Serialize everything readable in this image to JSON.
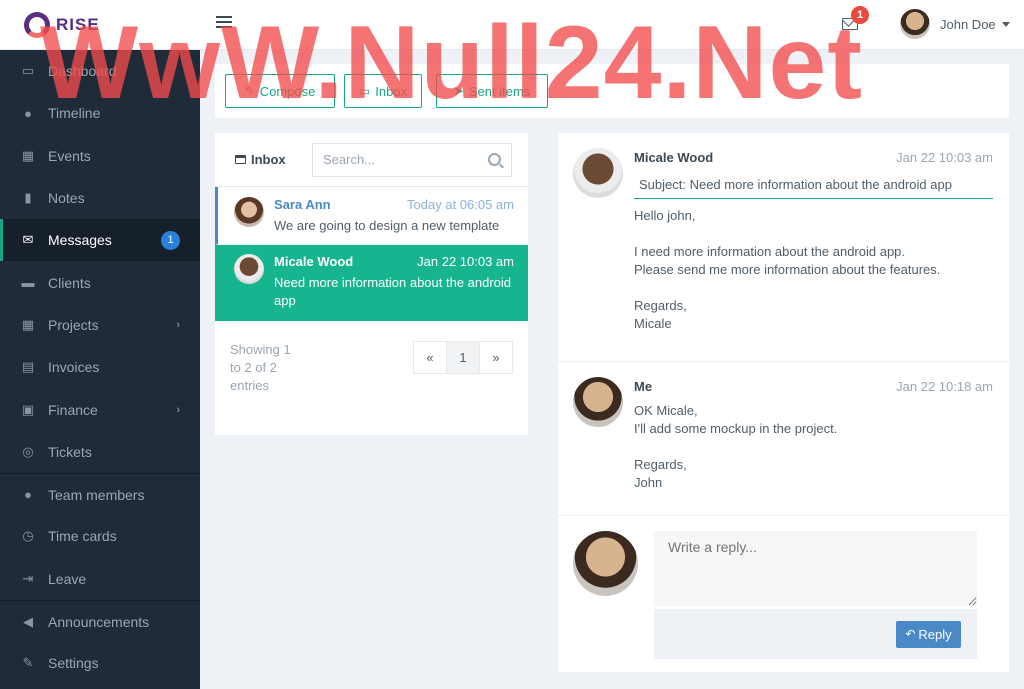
{
  "app": {
    "brand": "RISE"
  },
  "header": {
    "notification_count": "1",
    "user_name": "John Doe"
  },
  "sidebar": {
    "items": [
      {
        "label": "Dashboard",
        "icon": "monitor-icon"
      },
      {
        "label": "Timeline",
        "icon": "comments-icon"
      },
      {
        "label": "Events",
        "icon": "calendar-icon"
      },
      {
        "label": "Notes",
        "icon": "book-icon"
      },
      {
        "label": "Messages",
        "icon": "envelope-icon",
        "badge": "1",
        "active": true
      },
      {
        "label": "Clients",
        "icon": "briefcase-icon"
      },
      {
        "label": "Projects",
        "icon": "grid-icon"
      },
      {
        "label": "Invoices",
        "icon": "file-icon"
      },
      {
        "label": "Finance",
        "icon": "money-icon"
      },
      {
        "label": "Tickets",
        "icon": "lifebuoy-icon"
      },
      {
        "label": "Team members",
        "icon": "user-icon"
      },
      {
        "label": "Time cards",
        "icon": "clock-icon"
      },
      {
        "label": "Leave",
        "icon": "sign-out-icon"
      },
      {
        "label": "Announcements",
        "icon": "bullhorn-icon"
      },
      {
        "label": "Settings",
        "icon": "wrench-icon"
      }
    ]
  },
  "tabs": {
    "compose": "Compose",
    "inbox": "Inbox",
    "sent": "Sent items"
  },
  "inbox": {
    "title": "Inbox",
    "search_placeholder": "Search...",
    "messages": [
      {
        "from": "Sara Ann",
        "date": "Today at 06:05 am",
        "subject": "We are going to design a new template"
      },
      {
        "from": "Micale Wood",
        "date": "Jan 22 10:03 am",
        "subject": "Need more information about the android app"
      }
    ],
    "showing": "Showing 1 to 2 of 2 entries",
    "pager": {
      "prev": "«",
      "page": "1",
      "next": "»"
    }
  },
  "view": {
    "thread": [
      {
        "from": "Micale Wood",
        "date": "Jan 22 10:03 am",
        "subject": "Subject: Need more information about the android app",
        "body": "Hello john,\n\nI need more information about the android app.\nPlease send me more information about the features.\n\nRegards,\nMicale"
      },
      {
        "from": "Me",
        "date": "Jan 22 10:18 am",
        "body": "OK Micale,\nI'll add some mockup in the project.\n\nRegards,\nJohn"
      }
    ],
    "reply_placeholder": "Write a reply...",
    "reply_label": "Reply"
  },
  "watermark": "WwW.Null24.Net",
  "colors": {
    "accent": "#17a689",
    "sidebar": "#1f2b38",
    "link": "#4a89c6",
    "badge": "#e74c3c"
  }
}
